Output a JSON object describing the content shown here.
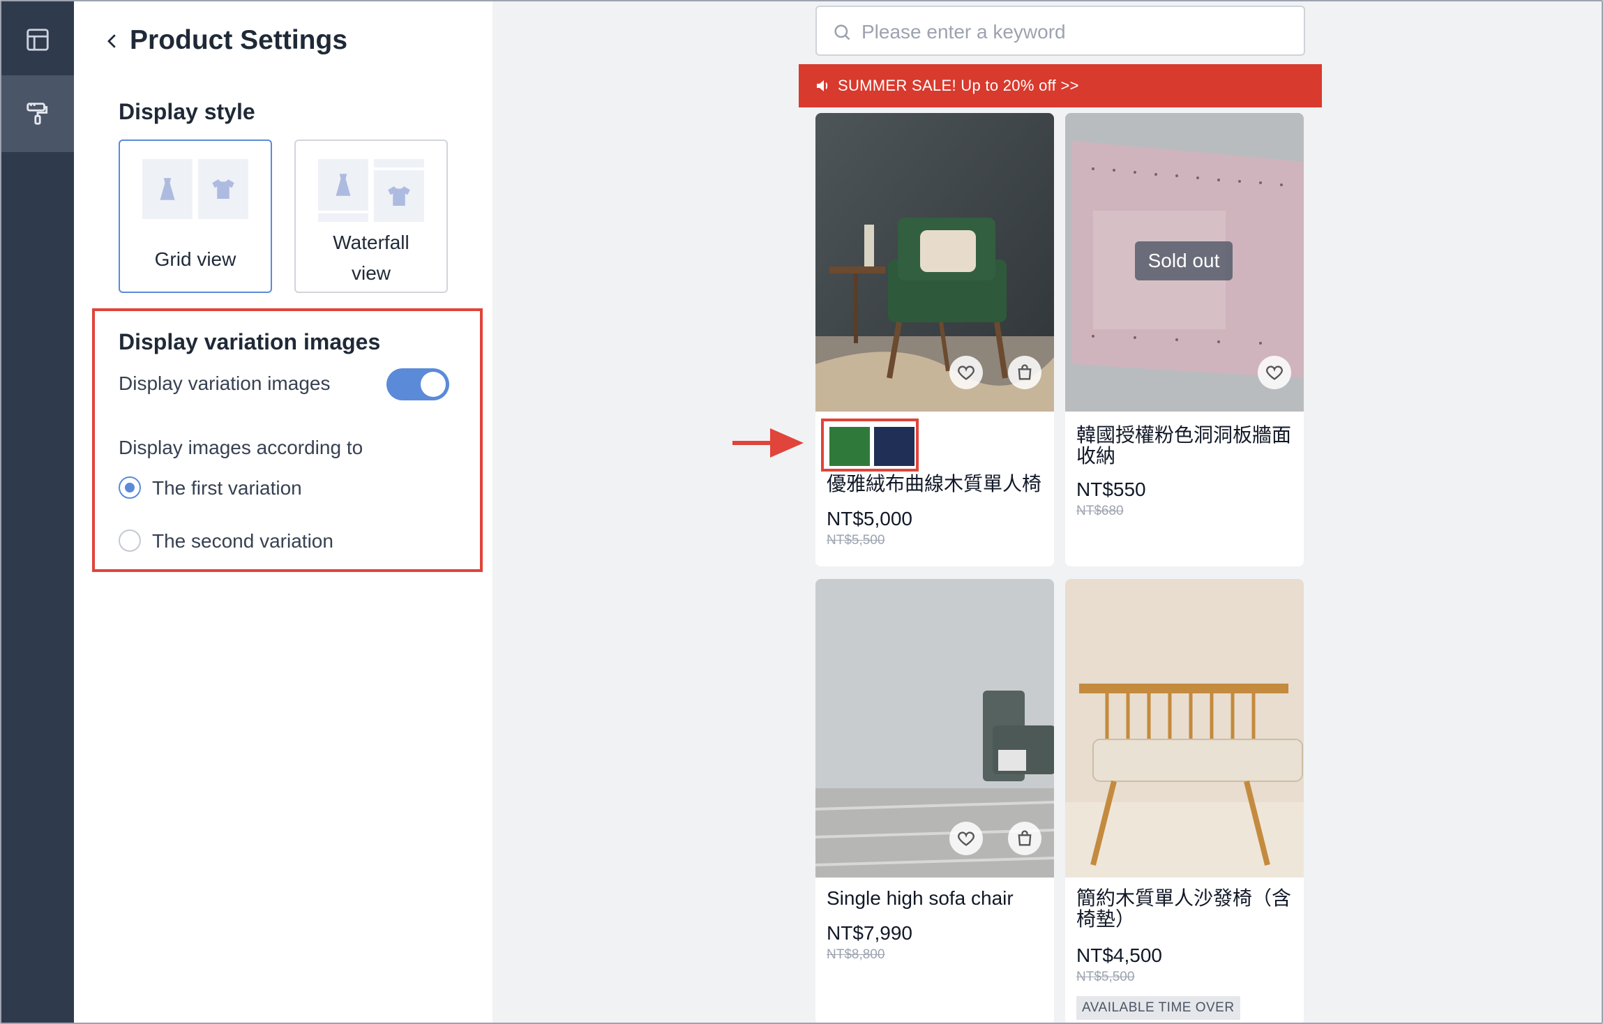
{
  "sidebar": {
    "items": [
      {
        "icon": "layout-icon"
      },
      {
        "icon": "paint-roller-icon"
      }
    ]
  },
  "panel": {
    "title": "Product Settings",
    "display_style": {
      "title": "Display style",
      "options": [
        {
          "label": "Grid view",
          "selected": true
        },
        {
          "label": "Waterfall view",
          "line1": "Waterfall",
          "line2": "view",
          "selected": false
        }
      ]
    },
    "variation": {
      "title": "Display variation images",
      "toggle_label": "Display variation images",
      "toggle_on": true,
      "according_label": "Display images according to",
      "radio_options": [
        {
          "label": "The first variation",
          "checked": true
        },
        {
          "label": "The second variation",
          "checked": false
        }
      ]
    }
  },
  "preview": {
    "search_placeholder": "Please enter a keyword",
    "banner": "SUMMER SALE! Up to 20% off >>",
    "products": [
      {
        "name": "優雅絨布曲線木質單人椅",
        "price": "NT$5,000",
        "original": "NT$5,500",
        "swatches": [
          "#2f7a3a",
          "#1f2f55"
        ]
      },
      {
        "name": "韓國授權粉色洞洞板牆面收納",
        "name_line1": "韓國授權粉色洞洞板牆面",
        "name_line2": "收納",
        "price": "NT$550",
        "original": "NT$680",
        "overlay": "Sold out"
      },
      {
        "name": "Single high sofa chair",
        "price": "NT$7,990",
        "original": "NT$8,800"
      },
      {
        "name": "簡約木質單人沙發椅（含椅墊）",
        "name_line1": "簡約木質單人沙發椅（含",
        "name_line2": "椅墊）",
        "price": "NT$4,500",
        "original": "NT$5,500",
        "badge": "AVAILABLE TIME OVER"
      }
    ]
  },
  "colors": {
    "accent": "#5b8ad8",
    "highlight": "#e0443a",
    "banner": "#d83a2e",
    "rail": "#2f3a4d"
  }
}
